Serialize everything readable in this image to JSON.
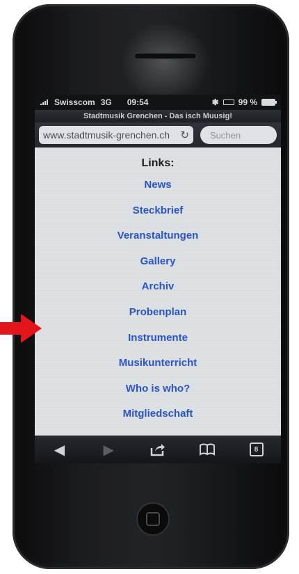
{
  "status_bar": {
    "carrier": "Swisscom",
    "network": "3G",
    "time": "09:54",
    "battery": "99 %",
    "battery_level": 0.99
  },
  "browser": {
    "page_title": "Stadtmusik Grenchen - Das isch Muusig!",
    "url": "www.stadtmusik-grenchen.ch",
    "search_placeholder": "Suchen"
  },
  "content": {
    "heading": "Links:",
    "nav_links": [
      "News",
      "Steckbrief",
      "Veranstaltungen",
      "Gallery",
      "Archiv",
      "Probenplan",
      "Instrumente",
      "Musikunterricht",
      "Who is who?",
      "Mitgliedschaft"
    ]
  },
  "toolbar": {
    "tab_count": "8",
    "icons": [
      "back-icon",
      "forward-icon",
      "share-icon",
      "bookmarks-icon",
      "tabs-icon"
    ]
  },
  "colors": {
    "link": "#2a54c8",
    "annotation_arrow": "#e3151b"
  }
}
